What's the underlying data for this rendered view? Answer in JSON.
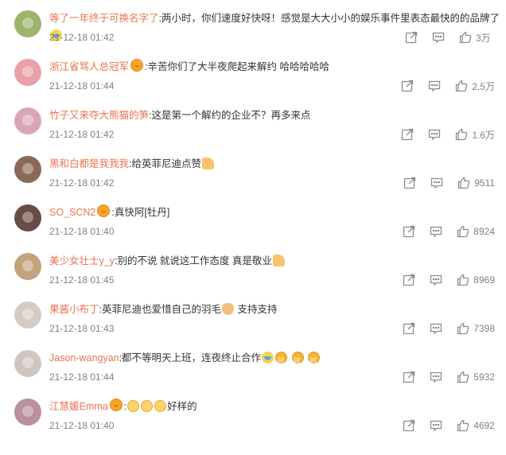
{
  "comments": [
    {
      "name": "等了一年终于可换名字了",
      "segments": [
        {
          "t": "text",
          "v": "两小时，你们速度好快呀！感觉是大大小小的娱乐事件里表态最快的的品牌了"
        },
        {
          "t": "emoji",
          "k": "laugh"
        }
      ],
      "time": "21-12-18 01:42",
      "likes": "3万",
      "avatar": "#9db36b"
    },
    {
      "name": "浙江省骂人总冠军",
      "badge": true,
      "segments": [
        {
          "t": "text",
          "v": "辛苦你们了大半夜爬起来解约 哈哈哈哈哈"
        }
      ],
      "time": "21-12-18 01:44",
      "likes": "2.5万",
      "avatar": "#e8a1a8"
    },
    {
      "name": "竹子又来夺大熊猫的笋",
      "segments": [
        {
          "t": "text",
          "v": "这是第一个解约的企业不？再多来点"
        }
      ],
      "time": "21-12-18 01:42",
      "likes": "1.6万",
      "avatar": "#d9a6b8"
    },
    {
      "name": "黑和白都是我我我",
      "segments": [
        {
          "t": "text",
          "v": "给英菲尼迪点赞"
        },
        {
          "t": "emoji",
          "k": "thumb"
        }
      ],
      "time": "21-12-18 01:42",
      "likes": "9511",
      "avatar": "#8a6a55"
    },
    {
      "name": "SO_SCN2",
      "badge": true,
      "segments": [
        {
          "t": "text",
          "v": "真快阿[牡丹]"
        }
      ],
      "time": "21-12-18 01:40",
      "likes": "8924",
      "avatar": "#6a4b45"
    },
    {
      "name": "美少女壮士y_y",
      "segments": [
        {
          "t": "text",
          "v": "别的不说 就说这工作态度 真是敬业"
        },
        {
          "t": "emoji",
          "k": "thumb"
        }
      ],
      "time": "21-12-18 01:45",
      "likes": "8969",
      "avatar": "#c4a27e"
    },
    {
      "name": "果酱小布丁",
      "segments": [
        {
          "t": "text",
          "v": "英菲尼迪也爱惜自己的羽毛"
        },
        {
          "t": "emoji",
          "k": "cat"
        },
        {
          "t": "text",
          "v": " 支持支持"
        }
      ],
      "time": "21-12-18 01:43",
      "likes": "7398",
      "avatar": "#d4ccc2"
    },
    {
      "name": "Jason-wangyan",
      "segments": [
        {
          "t": "text",
          "v": "都不等明天上班，连夜终止合作"
        },
        {
          "t": "emoji",
          "k": "laugh"
        },
        {
          "t": "emoji",
          "k": "coin"
        },
        {
          "t": "text",
          "v": " "
        },
        {
          "t": "emoji",
          "k": "coin"
        },
        {
          "t": "text",
          "v": " "
        },
        {
          "t": "emoji",
          "k": "coin"
        }
      ],
      "time": "21-12-18 01:44",
      "likes": "5932",
      "avatar": "#cfc6c2"
    },
    {
      "name": "江慧媛Emma",
      "badge": true,
      "segments": [
        {
          "t": "emoji",
          "k": "kid"
        },
        {
          "t": "emoji",
          "k": "kid"
        },
        {
          "t": "emoji",
          "k": "kid"
        },
        {
          "t": "text",
          "v": "好样的"
        }
      ],
      "time": "21-12-18 01:40",
      "likes": "4692",
      "avatar": "#b9909c"
    }
  ],
  "icons": {
    "share": "share-icon",
    "reply": "comment-icon",
    "like": "like-icon"
  },
  "colors": {
    "name": "#eb7350",
    "time": "#808080",
    "icon": "#8c8c8c"
  }
}
